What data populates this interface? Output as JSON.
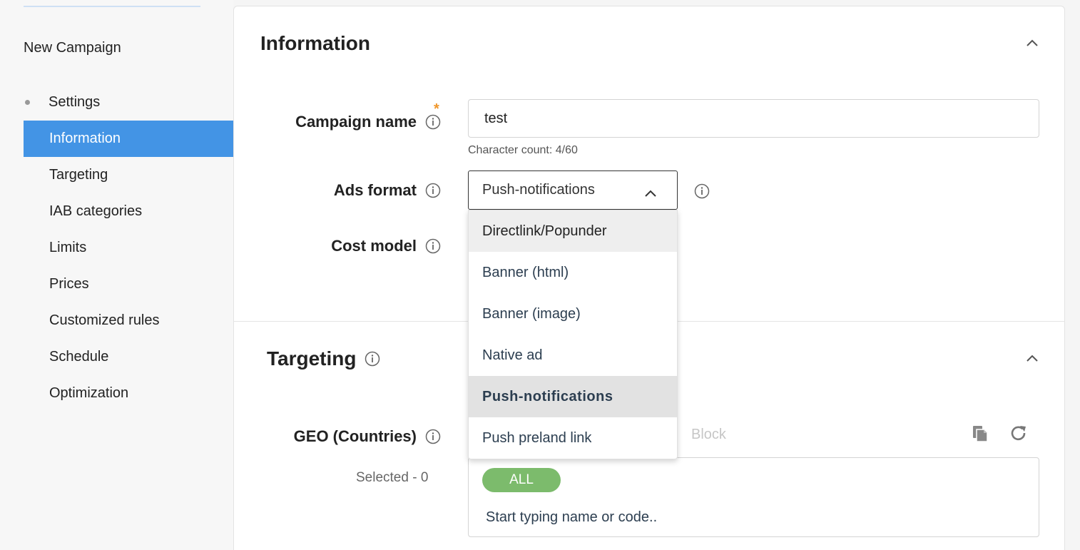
{
  "sidebar": {
    "title": "New Campaign",
    "section": "Settings",
    "items": [
      {
        "label": "Information",
        "active": true
      },
      {
        "label": "Targeting",
        "active": false
      },
      {
        "label": "IAB categories",
        "active": false
      },
      {
        "label": "Limits",
        "active": false
      },
      {
        "label": "Prices",
        "active": false
      },
      {
        "label": "Customized rules",
        "active": false
      },
      {
        "label": "Schedule",
        "active": false
      },
      {
        "label": "Optimization",
        "active": false
      }
    ]
  },
  "information": {
    "title": "Information",
    "campaign_name": {
      "label": "Campaign name",
      "required_mark": "*",
      "value": "test",
      "hint": "Character count: 4/60"
    },
    "ads_format": {
      "label": "Ads format",
      "value": "Push-notifications",
      "options": [
        {
          "label": "Directlink/Popunder",
          "state": "hover"
        },
        {
          "label": "Banner (html)",
          "state": ""
        },
        {
          "label": "Banner (image)",
          "state": ""
        },
        {
          "label": "Native ad",
          "state": ""
        },
        {
          "label": "Push-notifications",
          "state": "selected"
        },
        {
          "label": "Push preland link",
          "state": ""
        }
      ]
    },
    "cost_model": {
      "label": "Cost model"
    }
  },
  "targeting": {
    "title": "Targeting",
    "geo": {
      "label": "GEO (Countries)",
      "mode_label": "Block",
      "selected_count": "Selected - 0",
      "pill": "ALL",
      "placeholder": "Start typing name or code.."
    }
  },
  "colors": {
    "active_item": "#4394e5",
    "required_star": "#f0972b",
    "all_pill": "#7cbb6c"
  }
}
